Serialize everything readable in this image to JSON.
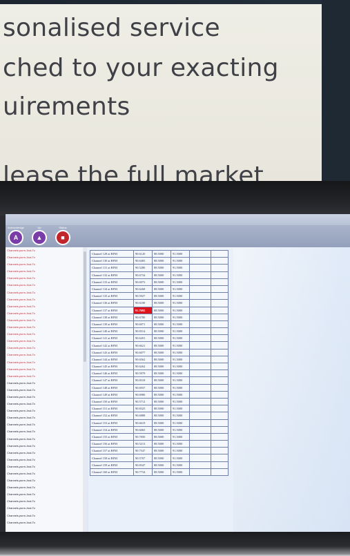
{
  "poster": {
    "lines": [
      "sonalised service",
      "ched to your exacting",
      "uirements",
      "lease the full market"
    ]
  },
  "toolbar": {
    "buttons": [
      {
        "caption": "Acknowledge",
        "icon": "A",
        "color": "#7a3da8"
      },
      {
        "caption": "Up",
        "icon": "▲",
        "color": "#7a3da8"
      },
      {
        "caption": "Status",
        "icon": "■",
        "color": "#c2242c"
      }
    ]
  },
  "sidebar": {
    "items": [
      "Channels.psrm.Jnal-To",
      "Channels.psrm.Jnal-To",
      "Channels.psrm.Jnal-To",
      "Channels.psrm.Jnal-To",
      "Channels.psrm.Jnal-To",
      "Channels.psrm.Jnal-To",
      "Channels.psrm.Jnal-To",
      "Channels.psrm.Jnal-To",
      "Channels.psrm.Jnal-To",
      "Channels.psrm.Jnal-To",
      "Channels.psrm.Jnal-To",
      "Channels.psrm.Jnal-To",
      "Channels.psrm.Jnal-To",
      "Channels.psrm.Jnal-To",
      "Channels.psrm.Jnal-To",
      "Channels.psrm.Jnal-To",
      "Channels.psrm.Jnal-To",
      "Channels.psrm.Jnal-To",
      "Channels.psrm.Jnal-To",
      "Channels.psrm.Jnal-To",
      "Channels.psrm.Jnal-To",
      "Channels.psrm.Jnal-To",
      "Channels.psrm.Jnal-To",
      "Channels.psrm.Jnal-To",
      "Channels.psrm.Jnal-To",
      "Channels.psrm.Jnal-To",
      "Channels.psrm.Jnal-To",
      "Channels.psrm.Jnal-To",
      "Channels.psrm.Jnal-To",
      "Channels.psrm.Jnal-To",
      "Channels.psrm.Jnal-To",
      "Channels.psrm.Jnal-To",
      "Channels.psrm.Jnal-To",
      "Channels.psrm.Jnal-To",
      "Channels.psrm.Jnal-To",
      "Channels.psrm.Jnal-To",
      "Channels.psrm.Jnal-To",
      "Channels.psrm.Jnal-To",
      "Channels.psrm.Jnal-To",
      "Channels.psrm.Jnal-To"
    ]
  },
  "table": {
    "rows": [
      [
        "Channel 128 at RFM",
        "90.6120",
        "88.5000",
        "91.5000"
      ],
      [
        "Channel 130 at RFM",
        "90.6405",
        "88.5000",
        "91.5000"
      ],
      [
        "Channel 131 at RFM",
        "90.5280",
        "88.5000",
        "91.5000"
      ],
      [
        "Channel 132 at RFM",
        "90.6734",
        "88.5000",
        "91.5000"
      ],
      [
        "Channel 133 at RFM",
        "90.6973",
        "88.5000",
        "91.5000"
      ],
      [
        "Channel 134 at RFM",
        "90.6268",
        "88.5000",
        "91.5000"
      ],
      [
        "Channel 135 at RFM",
        "90.5927",
        "88.5000",
        "91.5000"
      ],
      [
        "Channel 136 at RFM",
        "90.6180",
        "88.5000",
        "91.5000"
      ],
      [
        "Channel 137 at RFM",
        "91.7692",
        "88.5000",
        "91.5000"
      ],
      [
        "Channel 138 at RFM",
        "90.6780",
        "88.5000",
        "91.5000"
      ],
      [
        "Channel 139 at RFM",
        "90.6971",
        "88.5000",
        "91.5000"
      ],
      [
        "Channel 140 at RFM",
        "90.8314",
        "88.5000",
        "91.5000"
      ],
      [
        "Channel 141 at RFM",
        "90.6201",
        "88.5000",
        "91.5000"
      ],
      [
        "Channel 142 at RFM",
        "90.6621",
        "88.5000",
        "91.5000"
      ],
      [
        "Channel 143 at RFM",
        "90.6077",
        "88.5000",
        "91.5000"
      ],
      [
        "Channel 144 at RFM",
        "90.6562",
        "88.5000",
        "91.5000"
      ],
      [
        "Channel 145 at RFM",
        "90.6262",
        "88.5000",
        "91.5000"
      ],
      [
        "Channel 146 at RFM",
        "90.5979",
        "88.5000",
        "91.5000"
      ],
      [
        "Channel 147 at RFM",
        "90.8318",
        "88.5000",
        "91.5000"
      ],
      [
        "Channel 148 at RFM",
        "90.6937",
        "88.5000",
        "91.5000"
      ],
      [
        "Channel 149 at RFM",
        "90.6980",
        "88.5000",
        "91.5000"
      ],
      [
        "Channel 150 at RFM",
        "90.5712",
        "88.5000",
        "91.5000"
      ],
      [
        "Channel 151 at RFM",
        "90.8325",
        "88.5000",
        "91.5000"
      ],
      [
        "Channel 152 at RFM",
        "90.6888",
        "88.5000",
        "91.5000"
      ],
      [
        "Channel 153 at RFM",
        "90.6619",
        "88.5000",
        "91.5000"
      ],
      [
        "Channel 154 at RFM",
        "90.6065",
        "88.5000",
        "91.5000"
      ],
      [
        "Channel 155 at RFM",
        "90.7850",
        "88.5000",
        "91.5000"
      ],
      [
        "Channel 156 at RFM",
        "90.5213",
        "88.5000",
        "91.5000"
      ],
      [
        "Channel 157 at RFM",
        "90.7547",
        "88.5000",
        "91.5000"
      ],
      [
        "Channel 158 at RFM",
        "90.5707",
        "88.5000",
        "91.5000"
      ],
      [
        "Channel 159 at RFM",
        "90.8347",
        "88.5000",
        "91.5000"
      ],
      [
        "Channel 160 at RFM",
        "90.7734",
        "88.5000",
        "91.5000"
      ]
    ],
    "alarm_row": 8,
    "alarm_color": "#e0131c"
  }
}
